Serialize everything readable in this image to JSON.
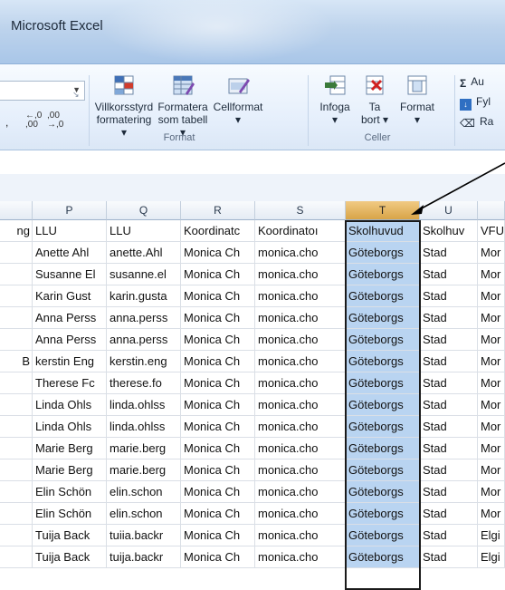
{
  "window": {
    "title": "Microsoft Excel"
  },
  "ribbon": {
    "number_format": {
      "comma": ",",
      "increase_decimals": "←,0 ,00",
      "decrease_decimals": ",00 →,0"
    },
    "styles": {
      "conditional": [
        "Villkorsstyrd",
        "formatering ▾"
      ],
      "format_table": [
        "Formatera",
        "som tabell ▾"
      ],
      "cell_styles": [
        "Cellformat",
        "▾"
      ],
      "group_label": "Format"
    },
    "cells": {
      "insert": [
        "Infoga",
        "▾"
      ],
      "delete": [
        "Ta",
        "bort ▾"
      ],
      "format": [
        "Format",
        "▾"
      ],
      "group_label": "Celler"
    },
    "editing": {
      "autosum": "Au",
      "fill": "Fyl",
      "clear": "Ra"
    }
  },
  "columns": [
    {
      "letter": "",
      "selected": false
    },
    {
      "letter": "P",
      "selected": false
    },
    {
      "letter": "Q",
      "selected": false
    },
    {
      "letter": "R",
      "selected": false
    },
    {
      "letter": "S",
      "selected": false
    },
    {
      "letter": "T",
      "selected": true
    },
    {
      "letter": "U",
      "selected": false
    },
    {
      "letter": "",
      "selected": false
    }
  ],
  "rows": [
    [
      "ng",
      "LLU",
      "LLU",
      "Koordinatc",
      "Koordinatoı",
      "Skolhuvud",
      "Skolhuv",
      "VFU"
    ],
    [
      "",
      "Anette Ahl",
      "anette.Ahl",
      "Monica Ch",
      "monica.cho",
      "Göteborgs",
      "Stad",
      "Mor"
    ],
    [
      "",
      "Susanne El",
      "susanne.el",
      "Monica Ch",
      "monica.cho",
      "Göteborgs",
      "Stad",
      "Mor"
    ],
    [
      "",
      "Karin Gust",
      "karin.gusta",
      "Monica Ch",
      "monica.cho",
      "Göteborgs",
      "Stad",
      "Mor"
    ],
    [
      "",
      "Anna Perss",
      "anna.perss",
      "Monica Ch",
      "monica.cho",
      "Göteborgs",
      "Stad",
      "Mor"
    ],
    [
      "",
      "Anna Perss",
      "anna.perss",
      "Monica Ch",
      "monica.cho",
      "Göteborgs",
      "Stad",
      "Mor"
    ],
    [
      "B",
      "kerstin Eng",
      "kerstin.eng",
      "Monica Ch",
      "monica.cho",
      "Göteborgs",
      "Stad",
      "Mor"
    ],
    [
      "",
      "Therese Fc",
      "therese.fo",
      "Monica Ch",
      "monica.cho",
      "Göteborgs",
      "Stad",
      "Mor"
    ],
    [
      "",
      "Linda Ohls",
      "linda.ohlss",
      "Monica Ch",
      "monica.cho",
      "Göteborgs",
      "Stad",
      "Mor"
    ],
    [
      "",
      "Linda Ohls",
      "linda.ohlss",
      "Monica Ch",
      "monica.cho",
      "Göteborgs",
      "Stad",
      "Mor"
    ],
    [
      "",
      "Marie Berg",
      "marie.berg",
      "Monica Ch",
      "monica.cho",
      "Göteborgs",
      "Stad",
      "Mor"
    ],
    [
      "",
      "Marie Berg",
      "marie.berg",
      "Monica Ch",
      "monica.cho",
      "Göteborgs",
      "Stad",
      "Mor"
    ],
    [
      "",
      "Elin Schön",
      "elin.schon",
      "Monica Ch",
      "monica.cho",
      "Göteborgs",
      "Stad",
      "Mor"
    ],
    [
      "",
      "Elin Schön",
      "elin.schon",
      "Monica Ch",
      "monica.cho",
      "Göteborgs",
      "Stad",
      "Mor"
    ],
    [
      "",
      "Tuija Back",
      "tuiia.backr",
      "Monica Ch",
      "monica.cho",
      "Göteborgs",
      "Stad",
      "Elgi"
    ],
    [
      "",
      "Tuija Back",
      "tuija.backr",
      "Monica Ch",
      "monica.cho",
      "Göteborgs",
      "Stad",
      "Elgi"
    ]
  ],
  "colors": {
    "selection_fill": "#b9d4f1",
    "selected_header": "#f0c27b",
    "ribbon_bg": "#dfe9f7"
  }
}
